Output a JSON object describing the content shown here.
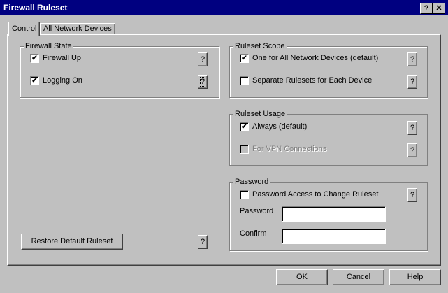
{
  "window": {
    "title": "Firewall Ruleset",
    "help_glyph": "?",
    "close_glyph": "✕"
  },
  "tabs": [
    {
      "label": "Control"
    },
    {
      "label": "All Network Devices"
    }
  ],
  "firewall_state": {
    "label": "Firewall State",
    "items": [
      {
        "label": "Firewall Up",
        "checked": true
      },
      {
        "label": "Logging On",
        "checked": true
      }
    ]
  },
  "ruleset_scope": {
    "label": "Ruleset Scope",
    "items": [
      {
        "label": "One for All Network Devices (default)",
        "checked": true
      },
      {
        "label": "Separate Rulesets for Each Device",
        "checked": false
      }
    ]
  },
  "ruleset_usage": {
    "label": "Ruleset Usage",
    "items": [
      {
        "label": "Always (default)",
        "checked": true
      },
      {
        "label": "For VPN Connections",
        "checked": false,
        "disabled": true
      }
    ]
  },
  "password": {
    "label": "Password",
    "access_label": "Password Access to Change Ruleset",
    "access_checked": false,
    "password_label": "Password",
    "password_value": "",
    "confirm_label": "Confirm",
    "confirm_value": ""
  },
  "buttons": {
    "restore": "Restore Default Ruleset",
    "help_q": "?",
    "ok": "OK",
    "cancel": "Cancel",
    "help": "Help"
  },
  "check_mark": "✔"
}
